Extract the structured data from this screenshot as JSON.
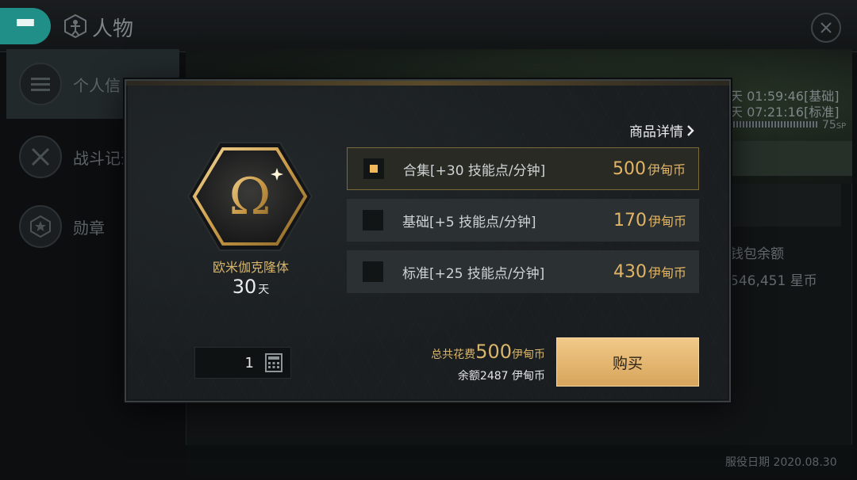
{
  "header": {
    "title": "人物"
  },
  "sidebar": {
    "items": [
      {
        "label": "个人信"
      },
      {
        "label": "战斗记录"
      },
      {
        "label": "勋章"
      }
    ]
  },
  "background": {
    "timer_lines": [
      "天 01:59:46[基础]",
      "天 07:21:16[标准]"
    ],
    "sp_value": "75",
    "sp_unit": "SP",
    "wallet_label": "钱包余额",
    "wallet_value": "546,451 星币",
    "service_date": "服役日期 2020.08.30"
  },
  "dialog": {
    "details_link": "商品详情",
    "item": {
      "name": "欧米伽克隆体",
      "symbol": "Ω",
      "duration_value": "30",
      "duration_unit": "天"
    },
    "options": [
      {
        "label": "合集[+30 技能点/分钟]",
        "price": "500",
        "currency": "伊甸币",
        "selected": true
      },
      {
        "label": "基础[+5 技能点/分钟]",
        "price": "170",
        "currency": "伊甸币",
        "selected": false
      },
      {
        "label": "标准[+25 技能点/分钟]",
        "price": "430",
        "currency": "伊甸币",
        "selected": false
      }
    ],
    "quantity": "1",
    "total_label": "总共花费",
    "total_value": "500",
    "total_currency": "伊甸币",
    "balance_text": "余额2487 伊甸币",
    "buy_label": "购买"
  },
  "colors": {
    "accent_teal": "#1f8f88",
    "gold": "#d9b56b",
    "buy_button": "#e8bb76"
  }
}
